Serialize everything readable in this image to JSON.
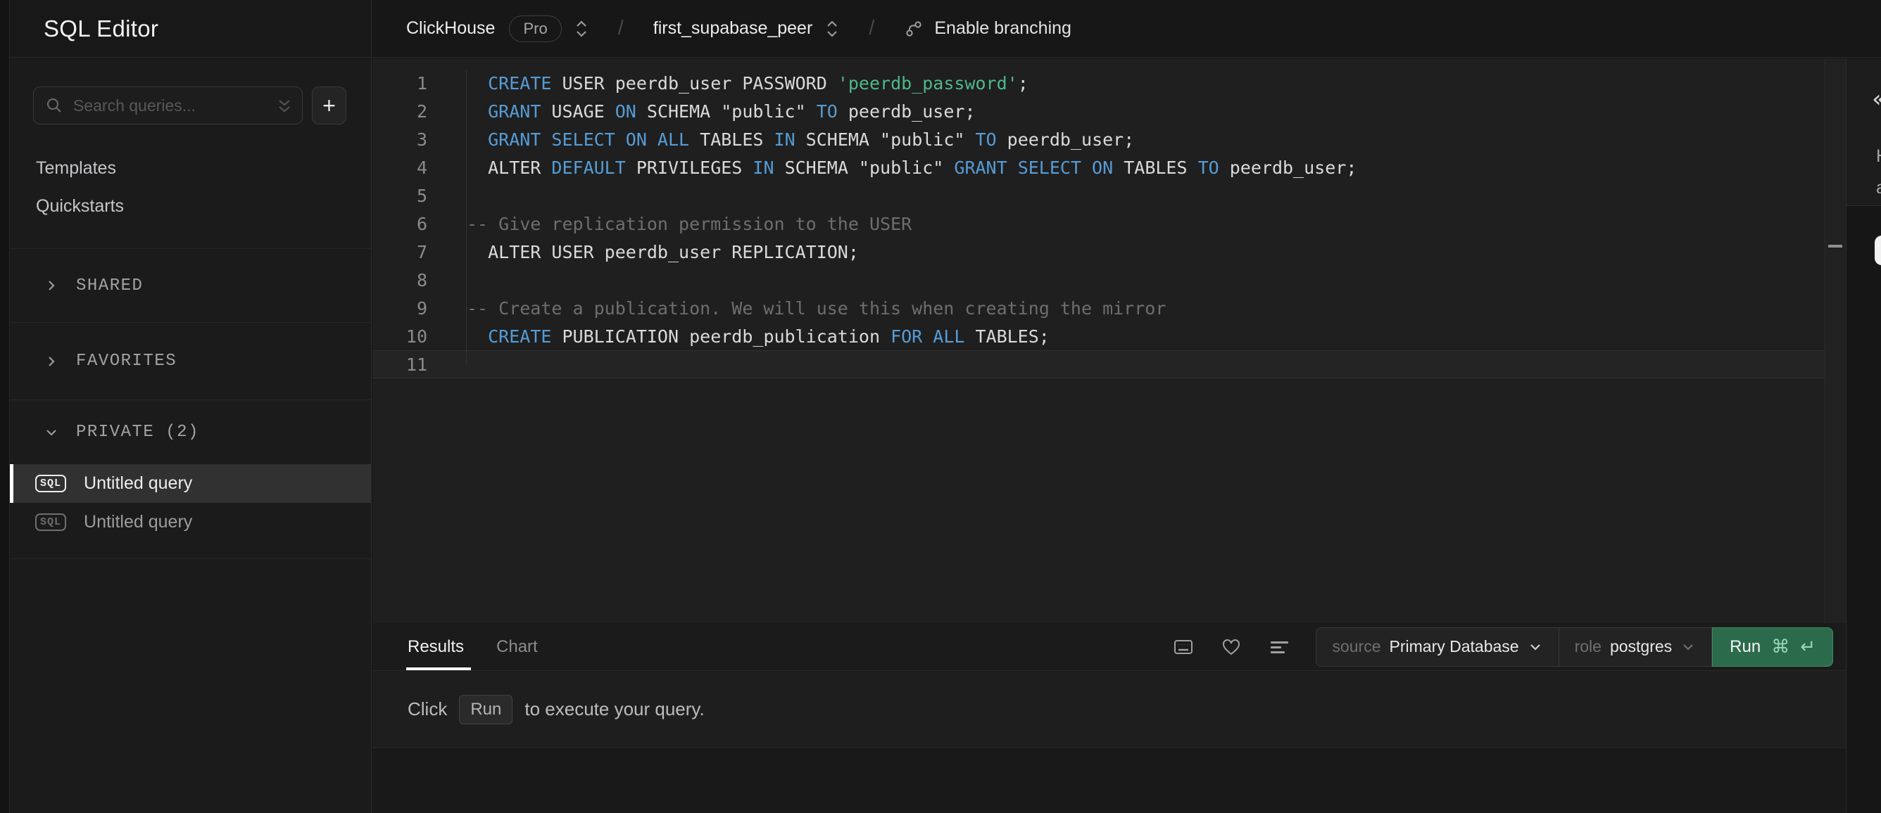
{
  "app": {
    "title": "SQL Editor"
  },
  "colors": {
    "run_button_bg": "#2b6b4c",
    "run_button_border": "#3e8a62",
    "syntax_keyword": "#569cd6",
    "syntax_string": "#4eb88a",
    "syntax_comment": "#6e6e6e",
    "selected_item_accent": "#ffffff",
    "active_tab_underline": "#ffffff"
  },
  "sidebar": {
    "search": {
      "placeholder": "Search queries...",
      "value": ""
    },
    "new_query_button": "+",
    "links": [
      "Templates",
      "Quickstarts"
    ],
    "sections": [
      {
        "label": "SHARED",
        "state": "collapsed"
      },
      {
        "label": "FAVORITES",
        "state": "collapsed"
      },
      {
        "label": "PRIVATE (2)",
        "state": "expanded"
      }
    ],
    "queries": [
      {
        "badge": "SQL",
        "label": "Untitled query",
        "selected": true
      },
      {
        "badge": "SQL",
        "label": "Untitled query",
        "selected": false
      }
    ]
  },
  "topbar": {
    "org": "ClickHouse",
    "plan": "Pro",
    "separator": "/",
    "project": "first_supabase_peer",
    "branch_label": "Enable branching"
  },
  "editor": {
    "lines": [
      {
        "n": "1",
        "current": false,
        "tokens": [
          [
            "pln",
            "  "
          ],
          [
            "kw",
            "CREATE"
          ],
          [
            "pln",
            " USER peerdb_user PASSWORD "
          ],
          [
            "str",
            "'peerdb_password'"
          ],
          [
            "pln",
            ";"
          ]
        ]
      },
      {
        "n": "2",
        "current": false,
        "tokens": [
          [
            "pln",
            "  "
          ],
          [
            "kw",
            "GRANT"
          ],
          [
            "pln",
            " USAGE "
          ],
          [
            "kw",
            "ON"
          ],
          [
            "pln",
            " SCHEMA \"public\" "
          ],
          [
            "kw",
            "TO"
          ],
          [
            "pln",
            " peerdb_user;"
          ]
        ]
      },
      {
        "n": "3",
        "current": false,
        "tokens": [
          [
            "pln",
            "  "
          ],
          [
            "kw",
            "GRANT SELECT ON ALL"
          ],
          [
            "pln",
            " TABLES "
          ],
          [
            "kw",
            "IN"
          ],
          [
            "pln",
            " SCHEMA \"public\" "
          ],
          [
            "kw",
            "TO"
          ],
          [
            "pln",
            " peerdb_user;"
          ]
        ]
      },
      {
        "n": "4",
        "current": false,
        "tokens": [
          [
            "pln",
            "  ALTER "
          ],
          [
            "kw",
            "DEFAULT"
          ],
          [
            "pln",
            " PRIVILEGES "
          ],
          [
            "kw",
            "IN"
          ],
          [
            "pln",
            " SCHEMA \"public\" "
          ],
          [
            "kw",
            "GRANT SELECT ON"
          ],
          [
            "pln",
            " TABLES "
          ],
          [
            "kw",
            "TO"
          ],
          [
            "pln",
            " peerdb_user;"
          ]
        ]
      },
      {
        "n": "5",
        "current": false,
        "tokens": []
      },
      {
        "n": "6",
        "current": false,
        "tokens": [
          [
            "com",
            "-- Give replication permission to the USER"
          ]
        ]
      },
      {
        "n": "7",
        "current": false,
        "tokens": [
          [
            "pln",
            "  ALTER USER peerdb_user REPLICATION;"
          ]
        ]
      },
      {
        "n": "8",
        "current": false,
        "tokens": []
      },
      {
        "n": "9",
        "current": false,
        "tokens": [
          [
            "com",
            "-- Create a publication. We will use this when creating the mirror"
          ]
        ]
      },
      {
        "n": "10",
        "current": false,
        "tokens": [
          [
            "pln",
            "  "
          ],
          [
            "kw",
            "CREATE"
          ],
          [
            "pln",
            " PUBLICATION peerdb_publication "
          ],
          [
            "kw",
            "FOR ALL"
          ],
          [
            "pln",
            " TABLES;"
          ]
        ]
      },
      {
        "n": "11",
        "current": true,
        "tokens": []
      }
    ]
  },
  "results": {
    "tabs": [
      {
        "label": "Results",
        "active": true
      },
      {
        "label": "Chart",
        "active": false
      }
    ],
    "source_label": "source",
    "source_value": "Primary Database",
    "role_label": "role",
    "role_value": "postgres",
    "run_label": "Run",
    "run_cmd": "⌘",
    "run_enter": "↵",
    "empty": {
      "prefix": "Click",
      "kbd": "Run",
      "suffix": "to execute your query."
    }
  },
  "right_panel": {
    "collapse_glyph": "«",
    "fragments": [
      "H",
      "a"
    ]
  }
}
